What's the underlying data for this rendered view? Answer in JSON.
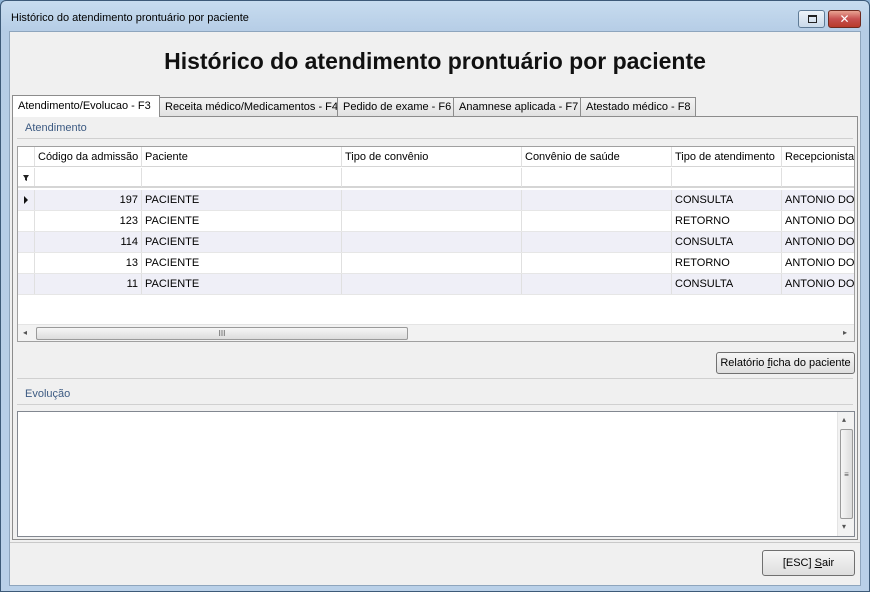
{
  "window": {
    "title": "Histórico do atendimento prontuário por paciente",
    "restore_glyph": "",
    "close_glyph": "✕"
  },
  "header": {
    "title": "Histórico do atendimento prontuário por paciente"
  },
  "tabs": [
    {
      "label": "Atendimento/Evolucao - F3",
      "active": true
    },
    {
      "label": "Receita médico/Medicamentos - F4",
      "active": false
    },
    {
      "label": "Pedido de exame - F6",
      "active": false
    },
    {
      "label": "Anamnese aplicada - F7",
      "active": false
    },
    {
      "label": "Atestado médico - F8",
      "active": false
    }
  ],
  "atendimento": {
    "caption": "Atendimento",
    "columns": [
      "Código da admissão",
      "Paciente",
      "Tipo de convênio",
      "Convênio de saúde",
      "Tipo de atendimento",
      "Recepcionista"
    ],
    "filter_icon": "funnel-icon",
    "rows": [
      {
        "codigo": "197",
        "paciente": "PACIENTE",
        "tipo_convenio": "",
        "convenio_saude": "",
        "tipo_atendimento": "CONSULTA",
        "recepcionista": "ANTONIO DOS"
      },
      {
        "codigo": "123",
        "paciente": "PACIENTE",
        "tipo_convenio": "",
        "convenio_saude": "",
        "tipo_atendimento": "RETORNO",
        "recepcionista": "ANTONIO DOS"
      },
      {
        "codigo": "114",
        "paciente": "PACIENTE",
        "tipo_convenio": "",
        "convenio_saude": "",
        "tipo_atendimento": "CONSULTA",
        "recepcionista": "ANTONIO DOS"
      },
      {
        "codigo": "13",
        "paciente": "PACIENTE",
        "tipo_convenio": "",
        "convenio_saude": "",
        "tipo_atendimento": "RETORNO",
        "recepcionista": "ANTONIO DOS"
      },
      {
        "codigo": "11",
        "paciente": "PACIENTE",
        "tipo_convenio": "",
        "convenio_saude": "",
        "tipo_atendimento": "CONSULTA",
        "recepcionista": "ANTONIO DOS"
      }
    ],
    "scroll_thumb_grip": "III",
    "report_button": {
      "pre": "Relatório ",
      "accel": "f",
      "post": "icha do paciente"
    }
  },
  "evolucao": {
    "caption": "Evolução",
    "text": "",
    "scroll_thumb_grip": "≡"
  },
  "footer": {
    "exit_button": {
      "pre": "[ESC] ",
      "accel": "S",
      "post": "air"
    }
  },
  "colors": {
    "accent_caption": "#3c5a82",
    "row_alt": "#efeff7",
    "window_frame": "#b9d0e8"
  }
}
